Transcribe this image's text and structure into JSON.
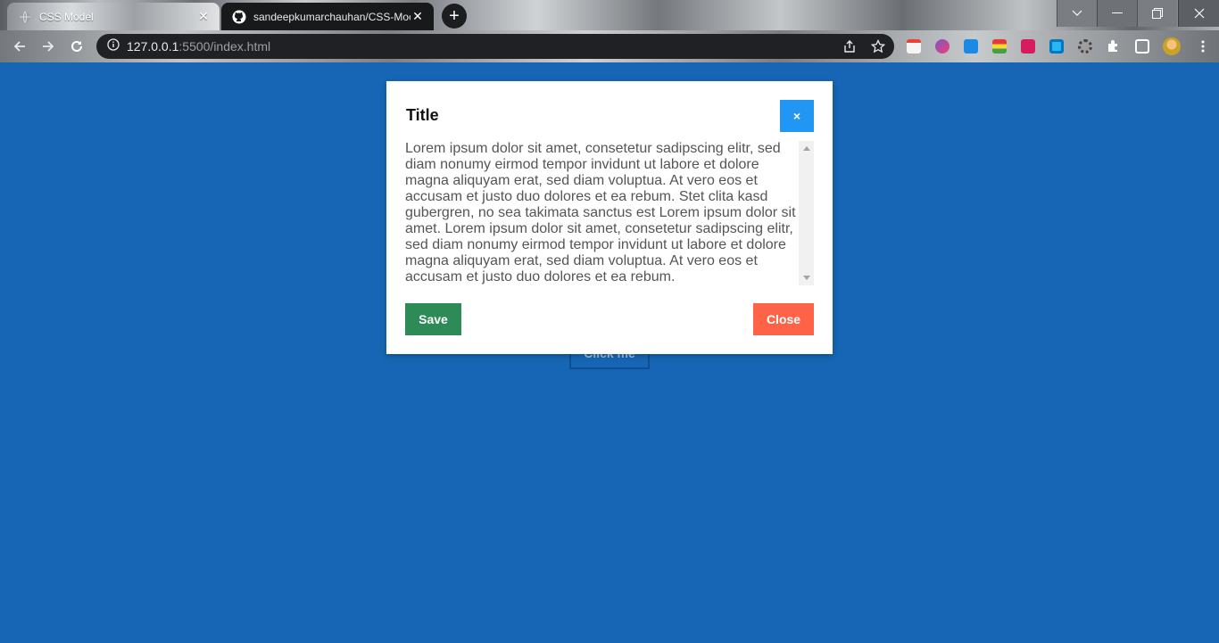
{
  "browser": {
    "tabs": [
      {
        "title": "CSS Model",
        "active": true,
        "favicon": "globe-icon"
      },
      {
        "title": "sandeepkumarchauhan/CSS-Moc",
        "active": false,
        "favicon": "github-icon"
      }
    ],
    "url_host": "127.0.0.1",
    "url_path": ":5500/index.html",
    "extensions": [
      "calendar-ext",
      "purple-ext",
      "css-ext",
      "palette-ext",
      "pink-ext",
      "window-ext",
      "gear-ext"
    ]
  },
  "page": {
    "background": "#1666b5",
    "open_button_label": "Click me"
  },
  "modal": {
    "title": "Title",
    "close_x_label": "×",
    "body": "Lorem ipsum dolor sit amet, consetetur sadipscing elitr, sed diam nonumy eirmod tempor invidunt ut labore et dolore magna aliquyam erat, sed diam voluptua. At vero eos et accusam et justo duo dolores et ea rebum. Stet clita kasd gubergren, no sea takimata sanctus est Lorem ipsum dolor sit amet. Lorem ipsum dolor sit amet, consetetur sadipscing elitr, sed diam nonumy eirmod tempor invidunt ut labore et dolore magna aliquyam erat, sed diam voluptua. At vero eos et accusam et justo duo dolores et ea rebum.",
    "save_label": "Save",
    "close_label": "Close",
    "colors": {
      "close_x": "#2196f3",
      "save": "#2e8b57",
      "close": "#ff6347"
    }
  }
}
